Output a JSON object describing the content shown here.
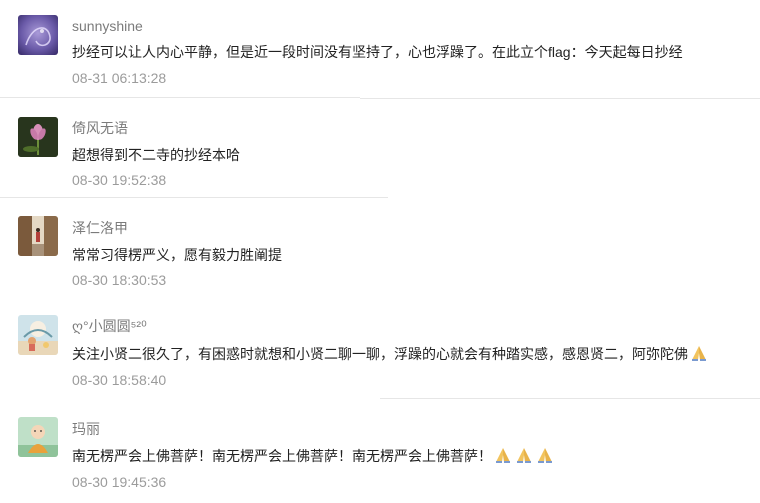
{
  "comments": [
    {
      "name": "sunnyshine",
      "text": "抄经可以让人内心平静，但是近一段时间没有坚持了，心也浮躁了。在此立个flag：今天起每日抄经",
      "time": "08-31 06:13:28",
      "avatar_icon": "purple-swirl-avatar",
      "emoji_count": 0
    },
    {
      "name": "倚风无语",
      "text": "超想得到不二寺的抄经本哈",
      "time": "08-30 19:52:38",
      "avatar_icon": "lotus-flower-avatar",
      "emoji_count": 0
    },
    {
      "name": "泽仁洛甲",
      "text": "常常习得楞严义，愿有毅力胜阐提",
      "time": "08-30 18:30:53",
      "avatar_icon": "street-photo-avatar",
      "emoji_count": 0
    },
    {
      "name": "ღ°小圆圆⁵²⁰",
      "text": "关注小贤二很久了，有困惑时就想和小贤二聊一聊，浮躁的心就会有种踏实感，感恩贤二，阿弥陀佛",
      "time": "08-30 18:58:40",
      "avatar_icon": "cartoon-girl-avatar",
      "emoji_count": 1
    },
    {
      "name": "玛丽",
      "text": "南无楞严会上佛菩萨！南无楞严会上佛菩萨！南无楞严会上佛菩萨！",
      "time": "08-30 19:45:36",
      "avatar_icon": "little-monk-avatar",
      "emoji_count": 3
    }
  ],
  "colors": {
    "name": "#7b7b7b",
    "text": "#222222",
    "time": "#9b9b9b",
    "divider": "#e6e6e6"
  }
}
